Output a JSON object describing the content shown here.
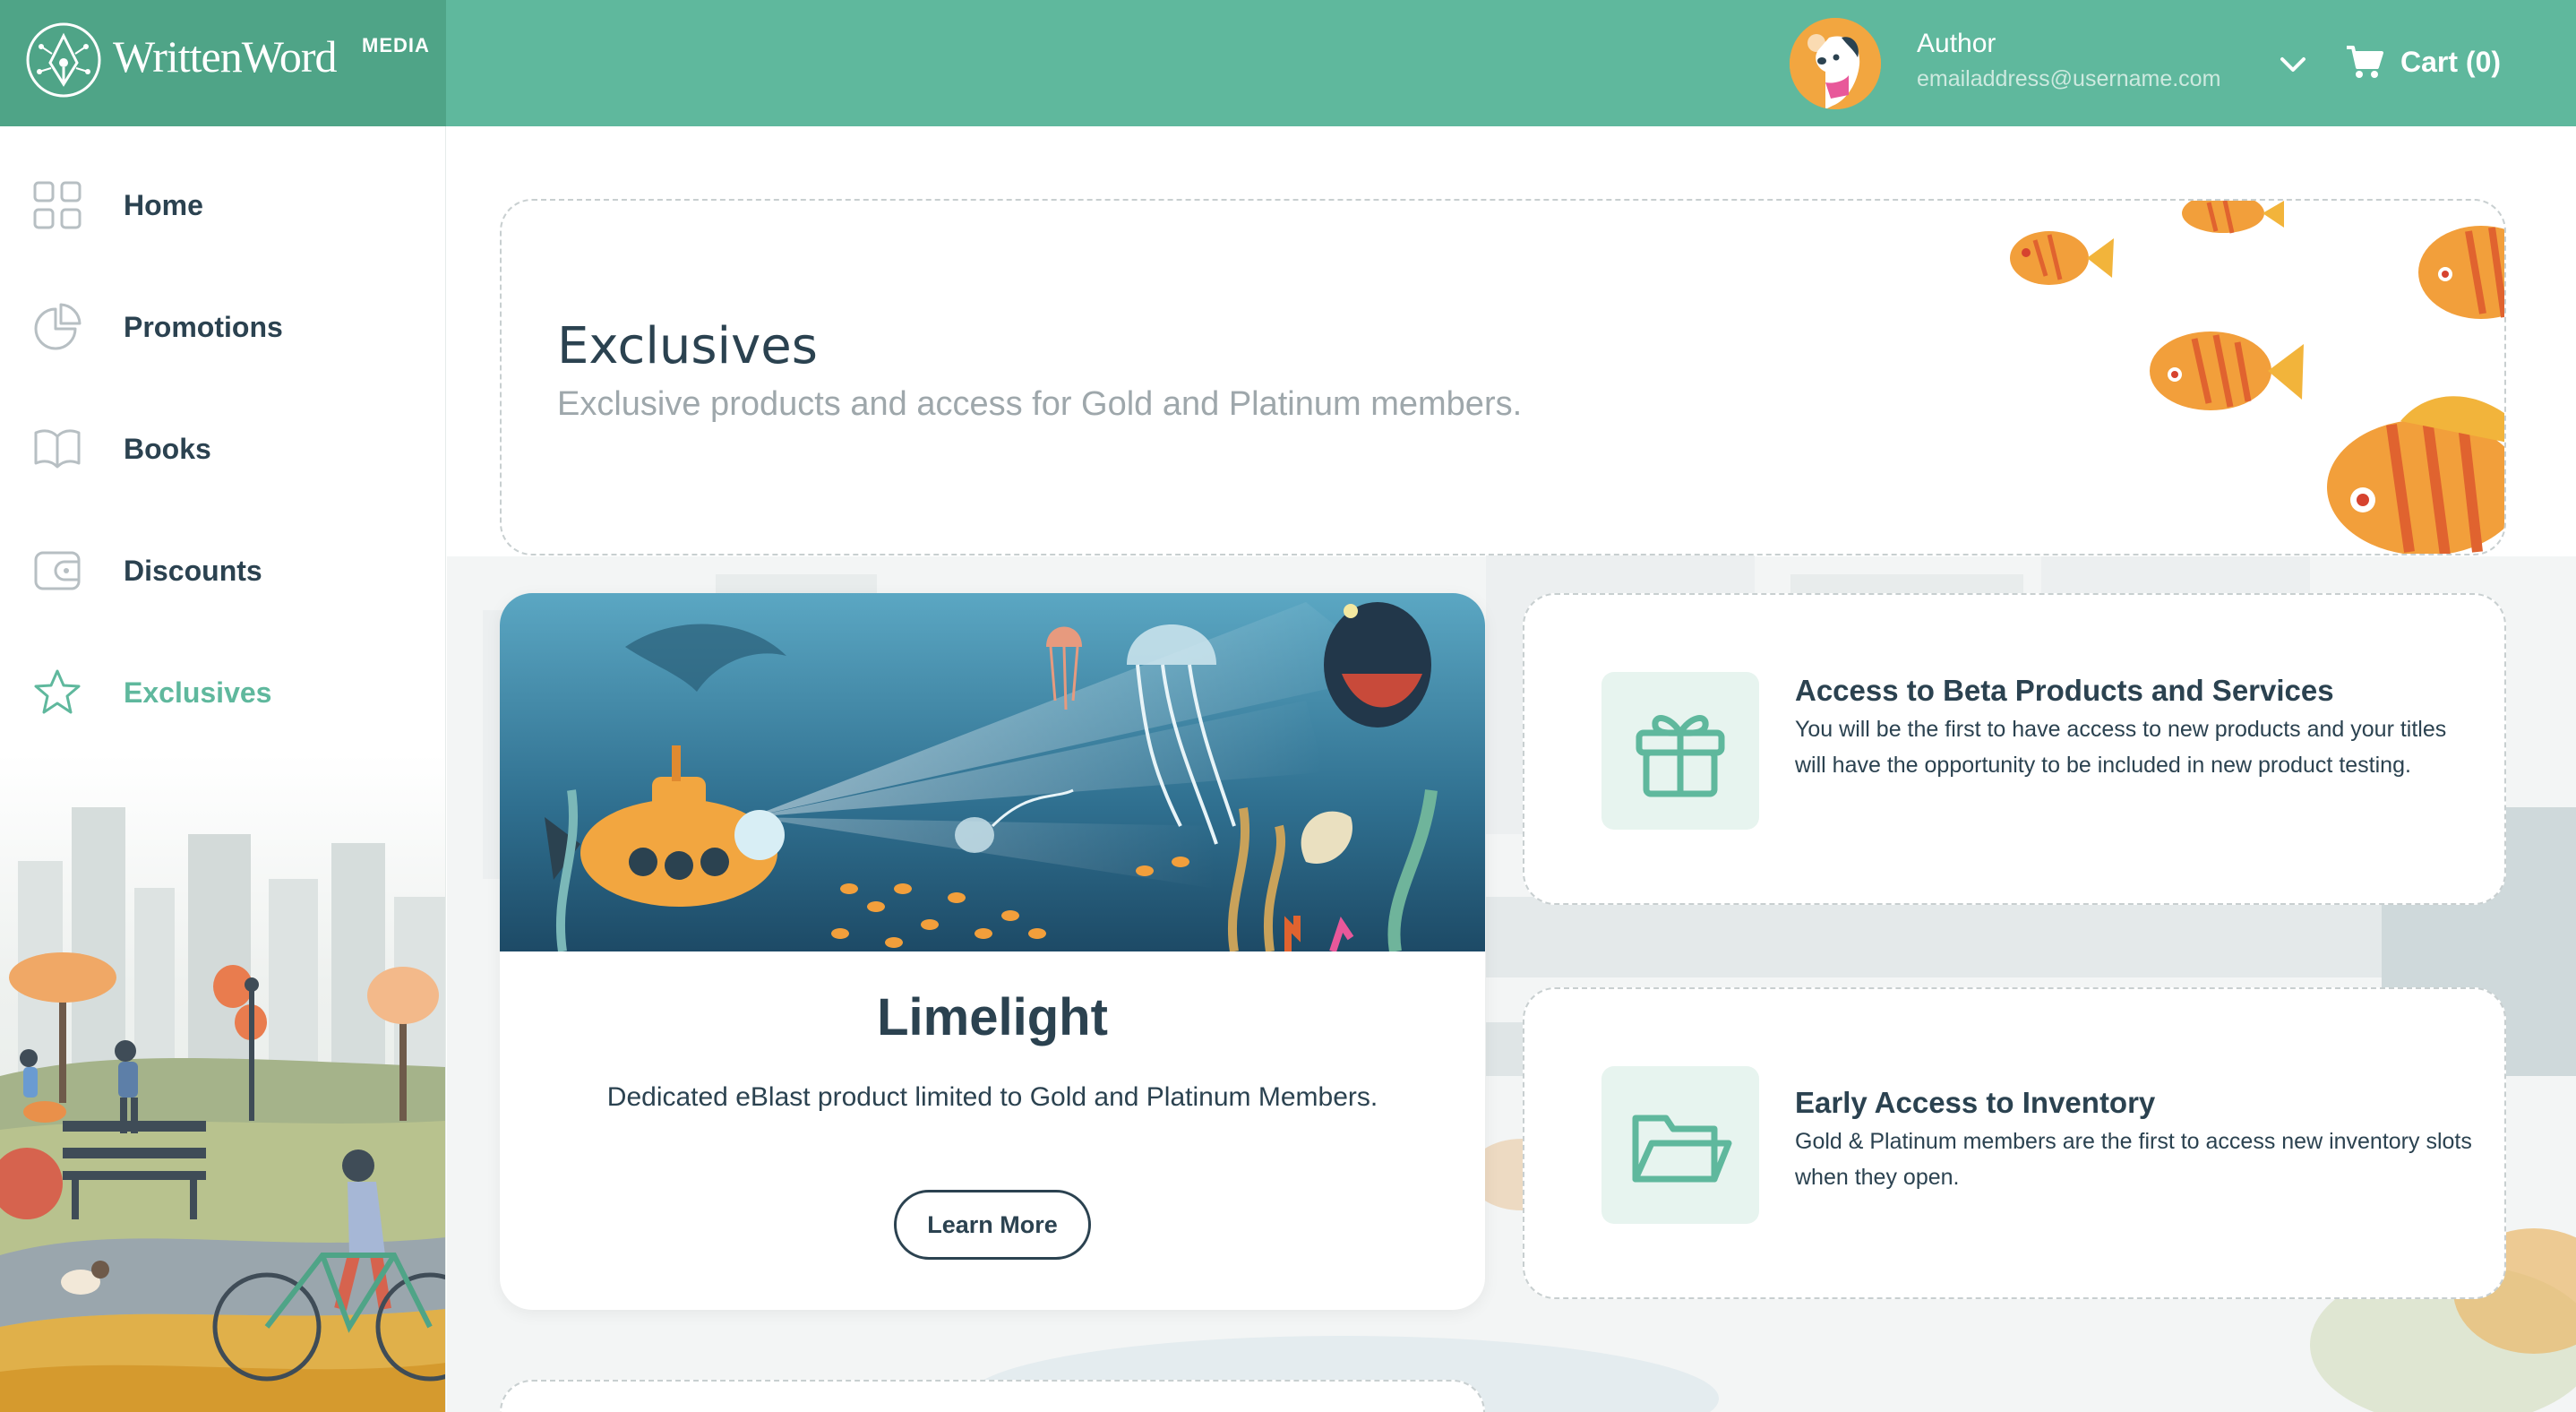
{
  "brand": {
    "name": "WrittenWord",
    "suffix": "MEDIA",
    "accent": "#5fb89d",
    "dark": "#2b4250"
  },
  "user": {
    "name": "Author",
    "email": "emailaddress@username.com"
  },
  "cart": {
    "label": "Cart (0)",
    "icon": "cart-icon"
  },
  "sidebar": {
    "items": [
      {
        "label": "Home",
        "icon": "grid-icon",
        "active": false
      },
      {
        "label": "Promotions",
        "icon": "pie-chart-icon",
        "active": false
      },
      {
        "label": "Books",
        "icon": "open-book-icon",
        "active": false
      },
      {
        "label": "Discounts",
        "icon": "wallet-icon",
        "active": false
      },
      {
        "label": "Exclusives",
        "icon": "star-icon",
        "active": true
      }
    ]
  },
  "hero": {
    "title": "Exclusives",
    "subtitle": "Exclusive products and access for Gold and Platinum members."
  },
  "limelight": {
    "title": "Limelight",
    "description": "Dedicated eBlast product limited to Gold and Platinum Members.",
    "button": "Learn More"
  },
  "features": [
    {
      "title": "Access to Beta Products and Services",
      "body": "You will be the first to have access to new products and your titles will have the opportunity to be included in new product testing.",
      "icon": "gift-icon"
    },
    {
      "title": "Early Access to Inventory",
      "body": "Gold & Platinum members are the first to access new inventory slots when they open.",
      "icon": "folder-icon"
    }
  ]
}
